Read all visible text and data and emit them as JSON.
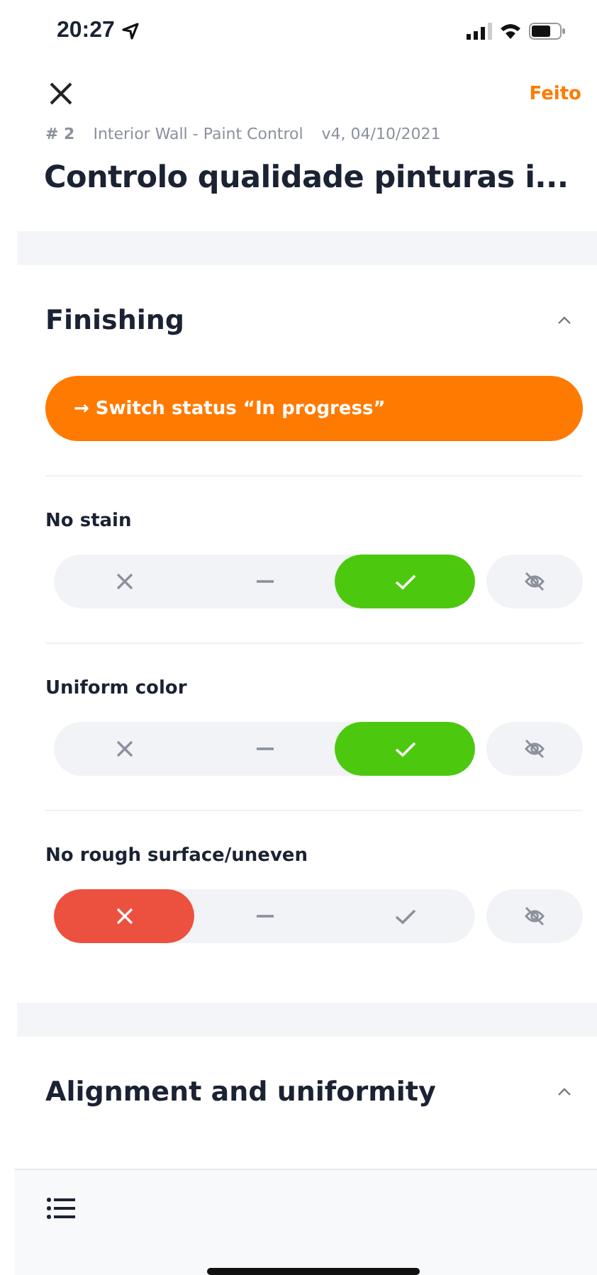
{
  "status_bar": {
    "time": "20:27"
  },
  "header": {
    "done": "Feito",
    "number": "# 2",
    "template": "Interior Wall - Paint Control",
    "version": "v4, 04/10/2021",
    "title": "Controlo qualidade pinturas i..."
  },
  "sections": [
    {
      "title": "Finishing",
      "expanded": true,
      "status_button": "→ Switch status “In progress”",
      "items": [
        {
          "label": "No stain",
          "options": [
            {
              "kind": "fail",
              "selected": false
            },
            {
              "kind": "na",
              "selected": false
            },
            {
              "kind": "pass",
              "selected": true
            },
            {
              "kind": "skip",
              "selected": false
            }
          ]
        },
        {
          "label": "Uniform color",
          "options": [
            {
              "kind": "fail",
              "selected": false
            },
            {
              "kind": "na",
              "selected": false
            },
            {
              "kind": "pass",
              "selected": true
            },
            {
              "kind": "skip",
              "selected": false
            }
          ]
        },
        {
          "label": "No rough surface/uneven",
          "options": [
            {
              "kind": "fail",
              "selected": true
            },
            {
              "kind": "na",
              "selected": false
            },
            {
              "kind": "pass",
              "selected": false
            },
            {
              "kind": "skip",
              "selected": false
            }
          ]
        }
      ]
    },
    {
      "title": "Alignment and uniformity",
      "expanded": true
    }
  ]
}
